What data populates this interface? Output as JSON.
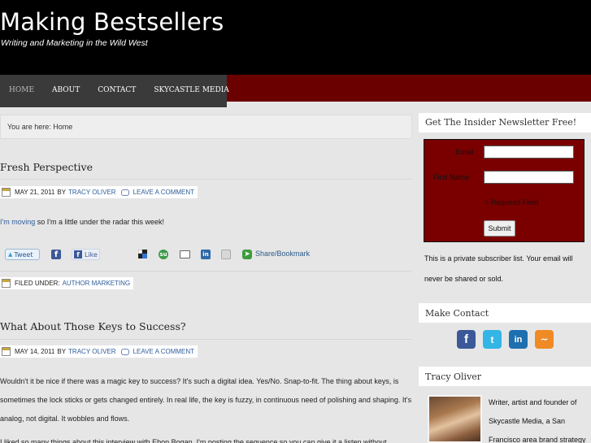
{
  "site": {
    "title": "Making Bestsellers",
    "tagline": "Writing and Marketing in the Wild West"
  },
  "nav": {
    "items": [
      {
        "label": "Home",
        "active": true
      },
      {
        "label": "About"
      },
      {
        "label": "Contact"
      },
      {
        "label": "Skycastle Media"
      }
    ]
  },
  "breadcrumb": "You are here: Home",
  "posts": [
    {
      "title": "Fresh Perspective",
      "date": "May 21, 2011",
      "by": "by",
      "author": "Tracy Oliver",
      "comment": "Leave a Comment",
      "link_text": "I'm moving",
      "text_after_link": " so I'm a little under the radar this week!",
      "share": {
        "tweet": "Tweet",
        "like": "Like",
        "bookmark": "Share/Bookmark"
      },
      "filed_under_label": "Filed Under:",
      "category": "Author Marketing"
    },
    {
      "title": "What About Those Keys to Success?",
      "date": "May 14, 2011",
      "by": "by",
      "author": "Tracy Oliver",
      "comment": "Leave a Comment",
      "paragraph": "Wouldn't it be nice if there was a magic key to success? It's such a digital idea. Yes/No. Snap-to-fit. The thing about keys, is sometimes the lock sticks or gets changed entirely. In real life, the key is fuzzy, in continuous need of polishing and shaping. It's analog, not digital. It wobbles and flows.",
      "next_line": "I liked so many things about this interview with Ebon Bogan. I'm posting the sequence so you can give it a listen without"
    }
  ],
  "sidebar": {
    "newsletter": {
      "title": "Get The Insider Newsletter Free!",
      "email_label": "Email",
      "first_name_label": "First Name",
      "required_note": "= Required Field",
      "submit": "Submit",
      "privacy": "This is a private subscriber list. Your email will never be shared or sold."
    },
    "contact": {
      "title": "Make Contact",
      "icons": [
        "facebook-icon",
        "twitter-icon",
        "linkedin-icon",
        "rss-icon"
      ]
    },
    "author": {
      "title": "Tracy Oliver",
      "bio": "Writer, artist and founder of Skycastle Media, a San Francisco area brand strategy"
    }
  },
  "colors": {
    "header_bg": "#000000",
    "nav_band": "#6b0000",
    "newsletter_bg": "#7a0000",
    "link": "#2f5d9a"
  }
}
